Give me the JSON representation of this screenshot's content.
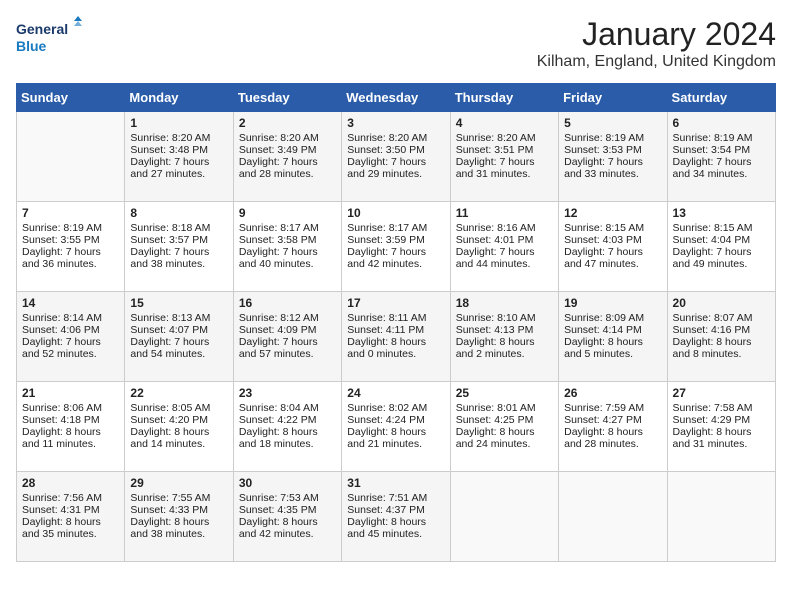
{
  "header": {
    "logo_line1": "General",
    "logo_line2": "Blue",
    "title": "January 2024",
    "subtitle": "Kilham, England, United Kingdom"
  },
  "days_of_week": [
    "Sunday",
    "Monday",
    "Tuesday",
    "Wednesday",
    "Thursday",
    "Friday",
    "Saturday"
  ],
  "weeks": [
    [
      {
        "num": "",
        "sunrise": "",
        "sunset": "",
        "daylight": ""
      },
      {
        "num": "1",
        "sunrise": "Sunrise: 8:20 AM",
        "sunset": "Sunset: 3:48 PM",
        "daylight": "Daylight: 7 hours and 27 minutes."
      },
      {
        "num": "2",
        "sunrise": "Sunrise: 8:20 AM",
        "sunset": "Sunset: 3:49 PM",
        "daylight": "Daylight: 7 hours and 28 minutes."
      },
      {
        "num": "3",
        "sunrise": "Sunrise: 8:20 AM",
        "sunset": "Sunset: 3:50 PM",
        "daylight": "Daylight: 7 hours and 29 minutes."
      },
      {
        "num": "4",
        "sunrise": "Sunrise: 8:20 AM",
        "sunset": "Sunset: 3:51 PM",
        "daylight": "Daylight: 7 hours and 31 minutes."
      },
      {
        "num": "5",
        "sunrise": "Sunrise: 8:19 AM",
        "sunset": "Sunset: 3:53 PM",
        "daylight": "Daylight: 7 hours and 33 minutes."
      },
      {
        "num": "6",
        "sunrise": "Sunrise: 8:19 AM",
        "sunset": "Sunset: 3:54 PM",
        "daylight": "Daylight: 7 hours and 34 minutes."
      }
    ],
    [
      {
        "num": "7",
        "sunrise": "Sunrise: 8:19 AM",
        "sunset": "Sunset: 3:55 PM",
        "daylight": "Daylight: 7 hours and 36 minutes."
      },
      {
        "num": "8",
        "sunrise": "Sunrise: 8:18 AM",
        "sunset": "Sunset: 3:57 PM",
        "daylight": "Daylight: 7 hours and 38 minutes."
      },
      {
        "num": "9",
        "sunrise": "Sunrise: 8:17 AM",
        "sunset": "Sunset: 3:58 PM",
        "daylight": "Daylight: 7 hours and 40 minutes."
      },
      {
        "num": "10",
        "sunrise": "Sunrise: 8:17 AM",
        "sunset": "Sunset: 3:59 PM",
        "daylight": "Daylight: 7 hours and 42 minutes."
      },
      {
        "num": "11",
        "sunrise": "Sunrise: 8:16 AM",
        "sunset": "Sunset: 4:01 PM",
        "daylight": "Daylight: 7 hours and 44 minutes."
      },
      {
        "num": "12",
        "sunrise": "Sunrise: 8:15 AM",
        "sunset": "Sunset: 4:03 PM",
        "daylight": "Daylight: 7 hours and 47 minutes."
      },
      {
        "num": "13",
        "sunrise": "Sunrise: 8:15 AM",
        "sunset": "Sunset: 4:04 PM",
        "daylight": "Daylight: 7 hours and 49 minutes."
      }
    ],
    [
      {
        "num": "14",
        "sunrise": "Sunrise: 8:14 AM",
        "sunset": "Sunset: 4:06 PM",
        "daylight": "Daylight: 7 hours and 52 minutes."
      },
      {
        "num": "15",
        "sunrise": "Sunrise: 8:13 AM",
        "sunset": "Sunset: 4:07 PM",
        "daylight": "Daylight: 7 hours and 54 minutes."
      },
      {
        "num": "16",
        "sunrise": "Sunrise: 8:12 AM",
        "sunset": "Sunset: 4:09 PM",
        "daylight": "Daylight: 7 hours and 57 minutes."
      },
      {
        "num": "17",
        "sunrise": "Sunrise: 8:11 AM",
        "sunset": "Sunset: 4:11 PM",
        "daylight": "Daylight: 8 hours and 0 minutes."
      },
      {
        "num": "18",
        "sunrise": "Sunrise: 8:10 AM",
        "sunset": "Sunset: 4:13 PM",
        "daylight": "Daylight: 8 hours and 2 minutes."
      },
      {
        "num": "19",
        "sunrise": "Sunrise: 8:09 AM",
        "sunset": "Sunset: 4:14 PM",
        "daylight": "Daylight: 8 hours and 5 minutes."
      },
      {
        "num": "20",
        "sunrise": "Sunrise: 8:07 AM",
        "sunset": "Sunset: 4:16 PM",
        "daylight": "Daylight: 8 hours and 8 minutes."
      }
    ],
    [
      {
        "num": "21",
        "sunrise": "Sunrise: 8:06 AM",
        "sunset": "Sunset: 4:18 PM",
        "daylight": "Daylight: 8 hours and 11 minutes."
      },
      {
        "num": "22",
        "sunrise": "Sunrise: 8:05 AM",
        "sunset": "Sunset: 4:20 PM",
        "daylight": "Daylight: 8 hours and 14 minutes."
      },
      {
        "num": "23",
        "sunrise": "Sunrise: 8:04 AM",
        "sunset": "Sunset: 4:22 PM",
        "daylight": "Daylight: 8 hours and 18 minutes."
      },
      {
        "num": "24",
        "sunrise": "Sunrise: 8:02 AM",
        "sunset": "Sunset: 4:24 PM",
        "daylight": "Daylight: 8 hours and 21 minutes."
      },
      {
        "num": "25",
        "sunrise": "Sunrise: 8:01 AM",
        "sunset": "Sunset: 4:25 PM",
        "daylight": "Daylight: 8 hours and 24 minutes."
      },
      {
        "num": "26",
        "sunrise": "Sunrise: 7:59 AM",
        "sunset": "Sunset: 4:27 PM",
        "daylight": "Daylight: 8 hours and 28 minutes."
      },
      {
        "num": "27",
        "sunrise": "Sunrise: 7:58 AM",
        "sunset": "Sunset: 4:29 PM",
        "daylight": "Daylight: 8 hours and 31 minutes."
      }
    ],
    [
      {
        "num": "28",
        "sunrise": "Sunrise: 7:56 AM",
        "sunset": "Sunset: 4:31 PM",
        "daylight": "Daylight: 8 hours and 35 minutes."
      },
      {
        "num": "29",
        "sunrise": "Sunrise: 7:55 AM",
        "sunset": "Sunset: 4:33 PM",
        "daylight": "Daylight: 8 hours and 38 minutes."
      },
      {
        "num": "30",
        "sunrise": "Sunrise: 7:53 AM",
        "sunset": "Sunset: 4:35 PM",
        "daylight": "Daylight: 8 hours and 42 minutes."
      },
      {
        "num": "31",
        "sunrise": "Sunrise: 7:51 AM",
        "sunset": "Sunset: 4:37 PM",
        "daylight": "Daylight: 8 hours and 45 minutes."
      },
      {
        "num": "",
        "sunrise": "",
        "sunset": "",
        "daylight": ""
      },
      {
        "num": "",
        "sunrise": "",
        "sunset": "",
        "daylight": ""
      },
      {
        "num": "",
        "sunrise": "",
        "sunset": "",
        "daylight": ""
      }
    ]
  ]
}
